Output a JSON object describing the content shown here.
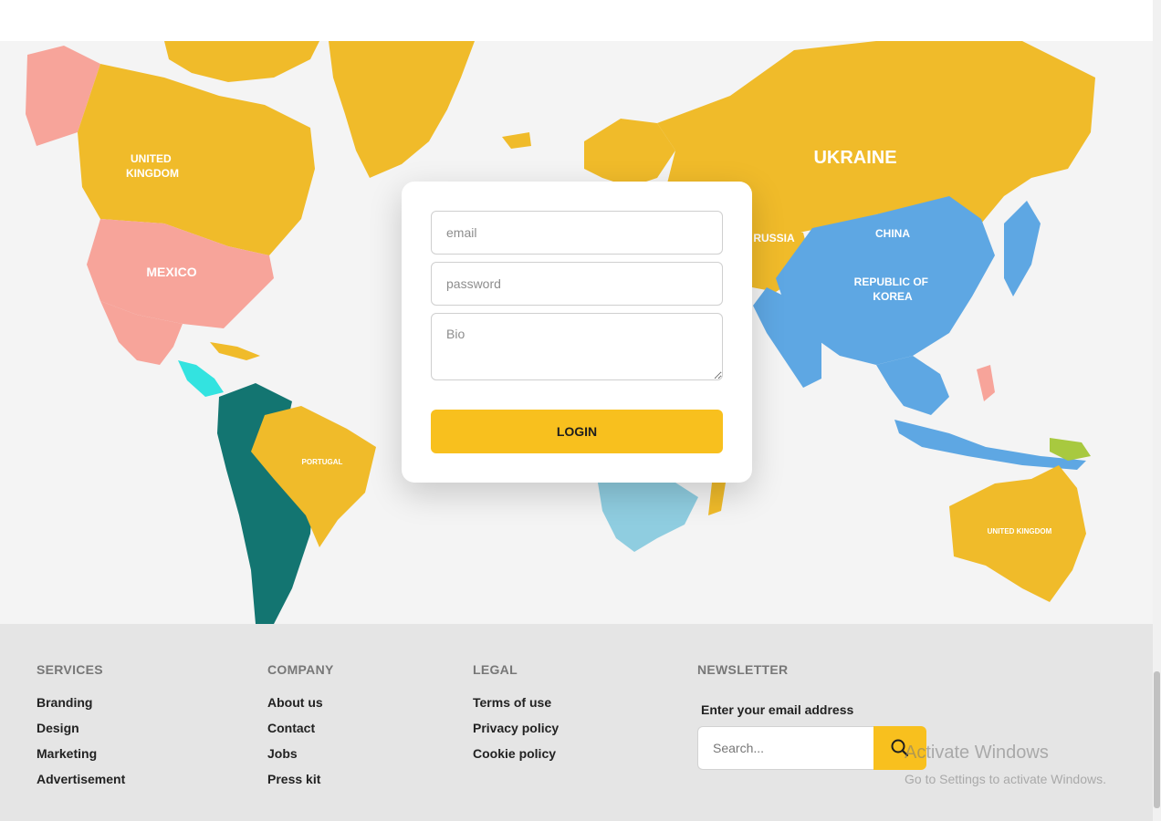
{
  "map": {
    "labels": {
      "united_kingdom_1": "UNITED\nKINGDOM",
      "mexico": "MEXICO",
      "ukraine": "UKRAINE",
      "russia": "RUSSIA",
      "china": "CHINA",
      "republic_of_korea": "REPUBLIC OF\nKOREA",
      "portugal": "PORTUGAL",
      "united_kingdom_2": "UNITED KINGDOM"
    },
    "colors": {
      "yellow": "#f0bb2a",
      "pink": "#f7a49a",
      "blue": "#5ea7e3",
      "teal": "#137571",
      "cyan": "#33e3e0",
      "lightblue": "#8fcde0",
      "green": "#a8c93f",
      "background": "#f4f4f4"
    }
  },
  "login_form": {
    "email_placeholder": "email",
    "password_placeholder": "password",
    "bio_placeholder": "Bio",
    "login_label": "LOGIN"
  },
  "footer": {
    "services": {
      "title": "SERVICES",
      "links": [
        "Branding",
        "Design",
        "Marketing",
        "Advertisement"
      ]
    },
    "company": {
      "title": "COMPANY",
      "links": [
        "About us",
        "Contact",
        "Jobs",
        "Press kit"
      ]
    },
    "legal": {
      "title": "LEGAL",
      "links": [
        "Terms of use",
        "Privacy policy",
        "Cookie policy"
      ]
    },
    "newsletter": {
      "title": "NEWSLETTER",
      "label": "Enter your email address",
      "search_placeholder": "Search..."
    }
  },
  "watermark": {
    "title": "Activate Windows",
    "subtitle": "Go to Settings to activate Windows."
  },
  "accent_color": "#f8c01e",
  "icons": {
    "search": "search-icon"
  }
}
